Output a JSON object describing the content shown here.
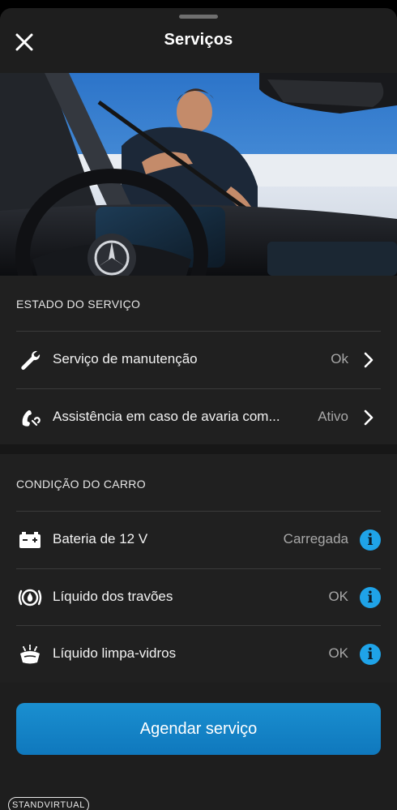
{
  "header": {
    "title": "Serviços",
    "close_icon": "close-icon"
  },
  "hero": {
    "alt": "hero-photo",
    "brand_icon": "mercedes-star-icon"
  },
  "service_status": {
    "title": "ESTADO DO SERVIÇO",
    "items": [
      {
        "icon": "wrench-icon",
        "label": "Serviço de manutenção",
        "value": "Ok",
        "action_icon": "chevron-right-icon"
      },
      {
        "icon": "phone-tool-icon",
        "label": "Assistência em caso de avaria com...",
        "value": "Ativo",
        "action_icon": "chevron-right-icon"
      }
    ]
  },
  "car_condition": {
    "title": "CONDIÇÃO DO CARRO",
    "items": [
      {
        "icon": "battery-icon",
        "label": "Bateria de 12 V",
        "value": "Carregada",
        "action_icon": "info-icon"
      },
      {
        "icon": "brake-fluid-icon",
        "label": "Líquido dos travões",
        "value": "OK",
        "action_icon": "info-icon"
      },
      {
        "icon": "washer-fluid-icon",
        "label": "Líquido limpa-vidros",
        "value": "OK",
        "action_icon": "info-icon"
      }
    ]
  },
  "info_glyph": "i",
  "cta": {
    "label": "Agendar serviço"
  },
  "watermark": {
    "text": "STANDVIRTUAL"
  },
  "colors": {
    "background": "#1e1e1e",
    "accent": "#1fa3e8",
    "button": "#1184c6",
    "muted_text": "#a8a8a8"
  }
}
